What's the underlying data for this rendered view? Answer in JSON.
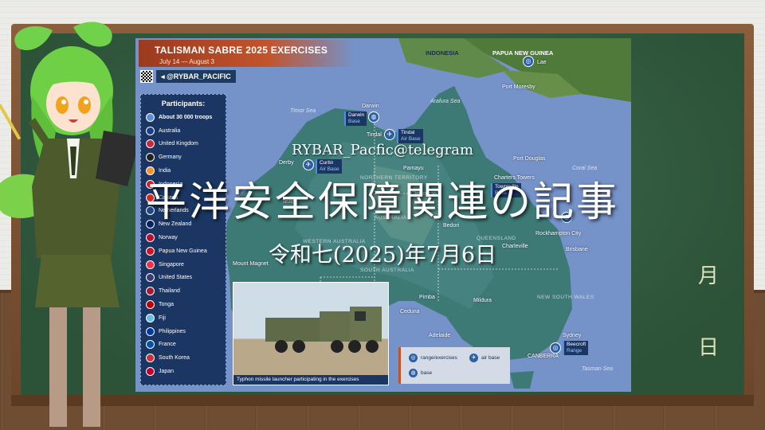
{
  "overlay": {
    "handle": "RYBAR_Pacfic@telegram",
    "title": "平洋安全保障関連の記事",
    "date": "令和七(2025)年7月6日"
  },
  "board": {
    "month_glyph": "月",
    "day_glyph": "日"
  },
  "map": {
    "title": "TALISMAN SABRE 2025 EXERCISES",
    "dates": "July 14 — August 3",
    "handle": "@RYBAR_PACIFIC",
    "participants_title": "Participants:",
    "participants": [
      {
        "name": "About 30 000 troops",
        "color": "#5a8fd8",
        "troops": true
      },
      {
        "name": "Australia",
        "color": "#1f3f8c"
      },
      {
        "name": "United Kingdom",
        "color": "#c8283c"
      },
      {
        "name": "Germany",
        "color": "#222222"
      },
      {
        "name": "India",
        "color": "#f39233"
      },
      {
        "name": "Indonesia",
        "color": "#d61f26"
      },
      {
        "name": "Canada",
        "color": "#d52b1e"
      },
      {
        "name": "Netherlands",
        "color": "#21468b"
      },
      {
        "name": "New Zealand",
        "color": "#012169"
      },
      {
        "name": "Norway",
        "color": "#ba0c2f"
      },
      {
        "name": "Papua New Guinea",
        "color": "#ce1126"
      },
      {
        "name": "Singapore",
        "color": "#ef3340"
      },
      {
        "name": "United States",
        "color": "#3c3b6e"
      },
      {
        "name": "Thailand",
        "color": "#a51931"
      },
      {
        "name": "Tonga",
        "color": "#c10000"
      },
      {
        "name": "Fiji",
        "color": "#68bfe5"
      },
      {
        "name": "Philippines",
        "color": "#0038a8"
      },
      {
        "name": "France",
        "color": "#0055a4"
      },
      {
        "name": "South Korea",
        "color": "#cd2e3a"
      },
      {
        "name": "Japan",
        "color": "#bc002d"
      }
    ],
    "photo_caption": "Typhon missile launcher participating in the exercises",
    "legend": {
      "range": "range/exercises",
      "air_base": "air base",
      "base": "base"
    },
    "seas": {
      "timor": "Timor Sea",
      "arafura": "Arafura Sea",
      "coral": "Coral Sea",
      "tasman": "Tasman Sea"
    },
    "countries": {
      "indonesia": "INDONESIA",
      "png": "PAPUA NEW GUINEA"
    },
    "regions": {
      "nt": "NORTHERN TERRITORY",
      "wa": "WESTERN AUSTRALIA",
      "sa": "SOUTH AUSTRALIA",
      "qld": "QUEENSLAND",
      "nsw": "NEW SOUTH WALES",
      "australia": "AUSTRALIA"
    },
    "places": {
      "lae": "Lae",
      "port_moresby": "Port Moresby",
      "darwin": "Darwin",
      "tindal": "Tindal",
      "derby": "Derby",
      "pamayu": "Pamayu",
      "cloncurry": "Cloncurry",
      "port_douglas": "Port Douglas",
      "charters_towers": "Charters Towers",
      "bedori": "Bedori",
      "rockhampton": "Rockhampton City",
      "brisbane": "Brisbane",
      "teifer": "Teifer",
      "mount_magnet": "Mount Magnet",
      "pimba": "Pimba",
      "ceduna": "Ceduna",
      "mildura": "Mildura",
      "adelaide": "Adelaide",
      "sydney": "Sydney",
      "canberra": "CANBERRA",
      "charleville": "Charleville"
    },
    "bases": {
      "darwin": {
        "name": "Darwin",
        "type": "Base"
      },
      "tindal": {
        "name": "Tindal",
        "type": "Air Base"
      },
      "curtin": {
        "name": "Curtin",
        "type": "Air Base"
      },
      "townsville": {
        "name": "Townsville",
        "type": "Base"
      },
      "beecroft": {
        "name": "Beecroft",
        "type": "Range"
      }
    }
  }
}
